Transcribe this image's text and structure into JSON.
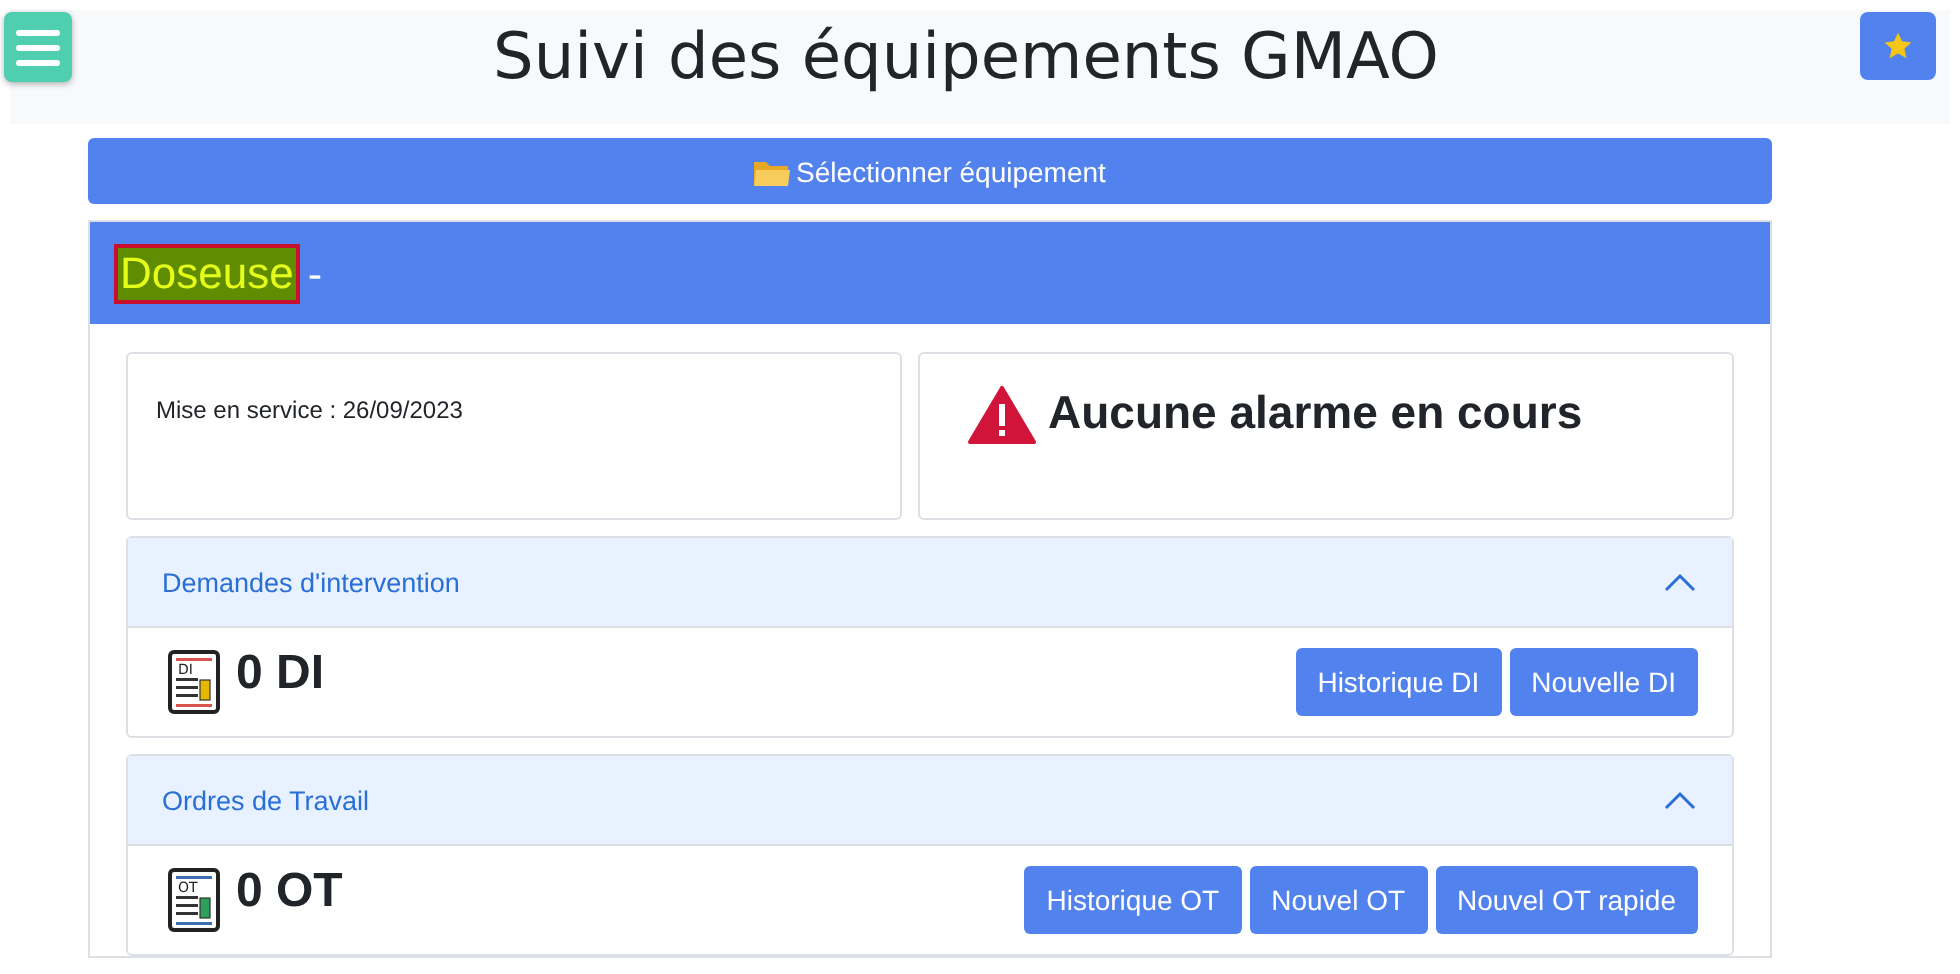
{
  "header": {
    "title": "Suivi des équipements GMAO"
  },
  "select_button": {
    "label": "Sélectionner équipement"
  },
  "equipment": {
    "name": "Doseuse",
    "separator": "-"
  },
  "info": {
    "commissioning": "Mise en service : 26/09/2023",
    "alarm": "Aucune alarme en cours"
  },
  "sections": [
    {
      "title": "Demandes d'intervention",
      "expanded": true,
      "icon_label": "DI",
      "kind": "di",
      "count": "0 DI",
      "buttons": [
        "Historique DI",
        "Nouvelle DI"
      ]
    },
    {
      "title": "Ordres de Travail",
      "expanded": true,
      "icon_label": "OT",
      "kind": "ot",
      "count": "0 OT",
      "buttons": [
        "Historique OT",
        "Nouvel OT",
        "Nouvel OT rapide"
      ]
    }
  ]
}
